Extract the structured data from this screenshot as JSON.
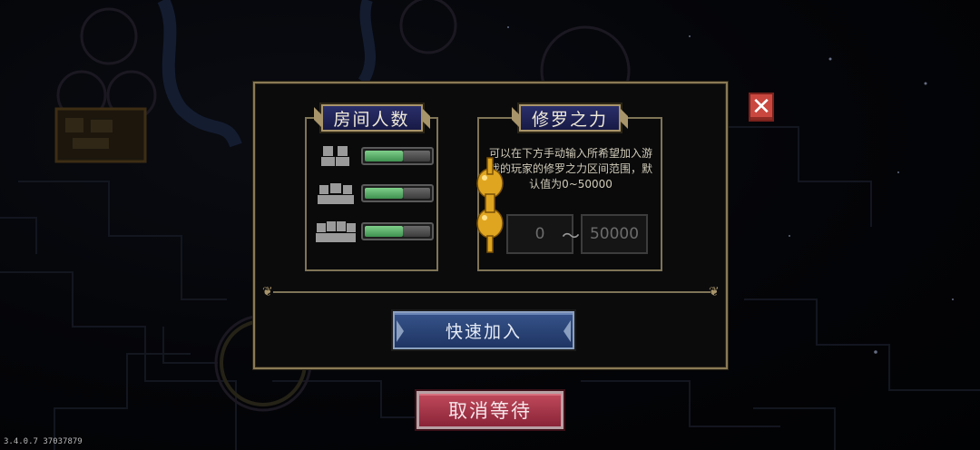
{
  "room_count": {
    "title": "房间人数",
    "rows": [
      {
        "icon": "two-players-icon",
        "enabled": true
      },
      {
        "icon": "three-players-icon",
        "enabled": true
      },
      {
        "icon": "four-players-icon",
        "enabled": true
      }
    ]
  },
  "asura_power": {
    "title": "修罗之力",
    "description": "可以在下方手动输入所希望加入游戏的玩家的修罗之力区间范围，默认值为0~50000",
    "min_placeholder": "0",
    "separator": "～",
    "max_placeholder": "50000"
  },
  "quick_join_label": "快速加入",
  "cancel_wait_label": "取消等待",
  "close_icon": "close-icon",
  "version": "3.4.0.7 37037879",
  "colors": {
    "frame": "#8a7a55",
    "plaque_blue": "#2a2f6a",
    "toggle_green": "#5fb06c",
    "quick_join_blue": "#36538a",
    "cancel_red": "#a8344a",
    "close_red": "#c9473f"
  }
}
